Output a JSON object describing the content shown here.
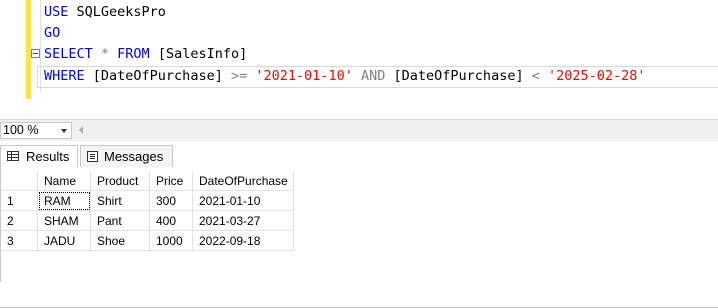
{
  "editor": {
    "lines": [
      [
        "USE ",
        "SQLGeeksPro"
      ],
      [
        "GO"
      ],
      [
        "SELECT ",
        "* ",
        "FROM ",
        "[SalesInfo]"
      ],
      [
        "WHERE ",
        "[DateOfPurchase] ",
        ">= ",
        "'2021-01-10' ",
        "AND ",
        "[DateOfPurchase] ",
        "< ",
        "'2025-02-28'"
      ]
    ]
  },
  "zoom": {
    "value": "100 %"
  },
  "tabs": {
    "results": "Results",
    "messages": "Messages"
  },
  "grid": {
    "columns": [
      "Name",
      "Product",
      "Price",
      "DateOfPurchase"
    ],
    "rows": [
      {
        "num": "1",
        "cells": [
          "RAM",
          "Shirt",
          "300",
          "2021-01-10"
        ]
      },
      {
        "num": "2",
        "cells": [
          "SHAM",
          "Pant",
          "400",
          "2021-03-27"
        ]
      },
      {
        "num": "3",
        "cells": [
          "JADU",
          "Shoe",
          "1000",
          "2022-09-18"
        ]
      }
    ]
  },
  "colors": {
    "keyword": "#0000ff",
    "string": "#ff0000",
    "operator": "#808080",
    "margin": "#f5e44c"
  }
}
